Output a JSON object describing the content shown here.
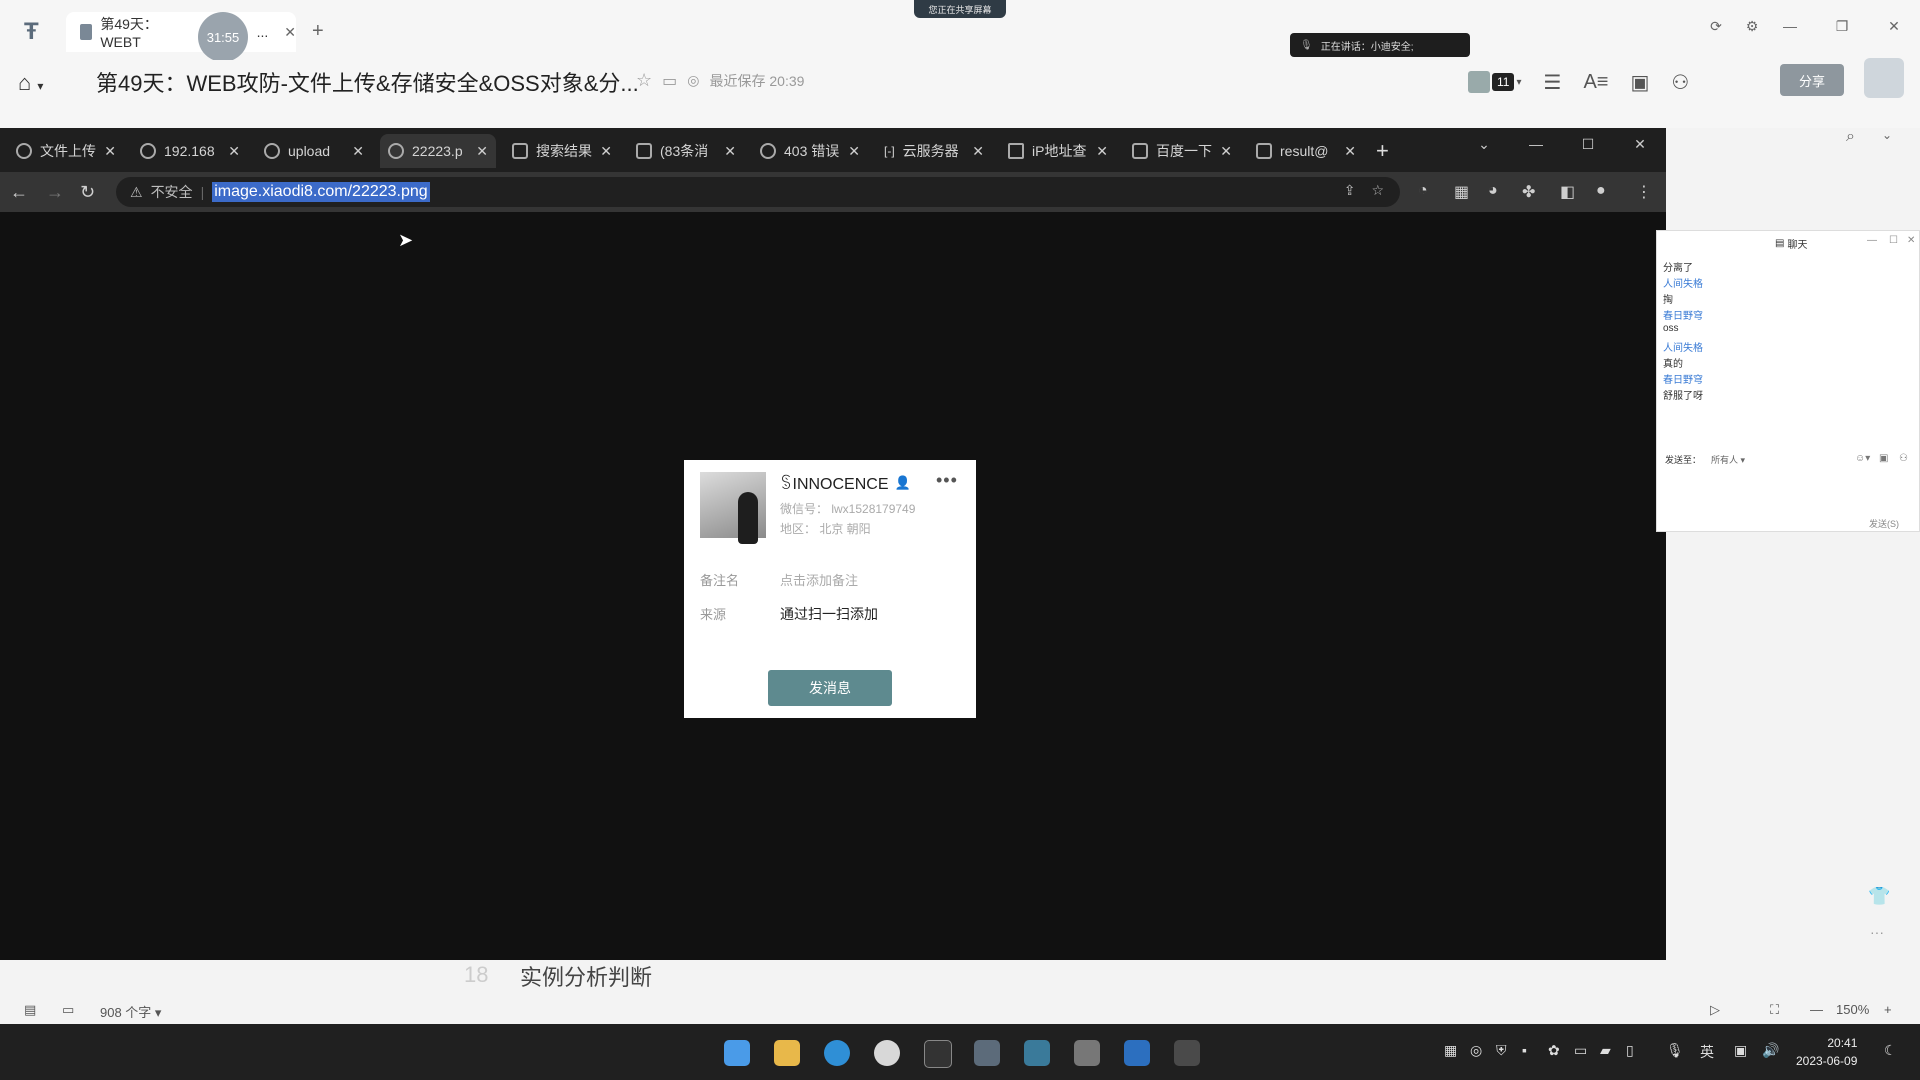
{
  "outer": {
    "tab_title": "第49天：WEBT",
    "tab_more": "...",
    "timer": "31:55",
    "share_indicator": "您正在共享屏幕",
    "speaking": "正在讲话：小迪安全;",
    "doc_title": "第49天：WEB攻防-文件上传&存储安全&OSS对象&分...",
    "saved": "最近保存 20:39",
    "participants": "11",
    "share_button": "分享"
  },
  "browser": {
    "tabs": [
      {
        "label": "文件上传"
      },
      {
        "label": "192.168"
      },
      {
        "label": "upload"
      },
      {
        "label": "22223.p"
      },
      {
        "label": "搜索结果"
      },
      {
        "label": "(83条消"
      },
      {
        "label": "403 错误"
      },
      {
        "label": "云服务器"
      },
      {
        "label": "iP地址查"
      },
      {
        "label": "百度一下"
      },
      {
        "label": "result@"
      }
    ],
    "insecure": "不安全",
    "url": "image.xiaodi8.com/22223.png"
  },
  "card": {
    "name": "ꌗINNOCENCE",
    "wechat_id": "微信号：  lwx1528179749",
    "region": "地区：  北京  朝阳",
    "remark_label": "备注名",
    "remark_value": "点击添加备注",
    "source_label": "来源",
    "source_value": "通过扫一扫添加",
    "button": "发消息"
  },
  "chat": {
    "title": "聊天",
    "messages": [
      {
        "text": "分离了",
        "color": "#333333"
      },
      {
        "text": "人间失格",
        "color": "#3a7bd5"
      },
      {
        "text": "掏",
        "color": "#333333"
      },
      {
        "text": "春日野穹",
        "color": "#3a7bd5"
      },
      {
        "text": "oss",
        "color": "#333333"
      },
      {
        "text": "人间失格",
        "color": "#3a7bd5"
      },
      {
        "text": "真的",
        "color": "#333333"
      },
      {
        "text": "春日野穹",
        "color": "#3a7bd5"
      },
      {
        "text": "舒服了呀",
        "color": "#333333"
      }
    ],
    "send_to": "发送至：",
    "everyone": "所有人 ▾",
    "send_button": "发送(S)"
  },
  "doc": {
    "line_number": "18",
    "heading": "实例分析判断",
    "word_count": "908 个字 ▾",
    "zoom": "150%"
  },
  "taskbar": {
    "lang": "英",
    "time": "20:41",
    "date": "2023-06-09"
  }
}
